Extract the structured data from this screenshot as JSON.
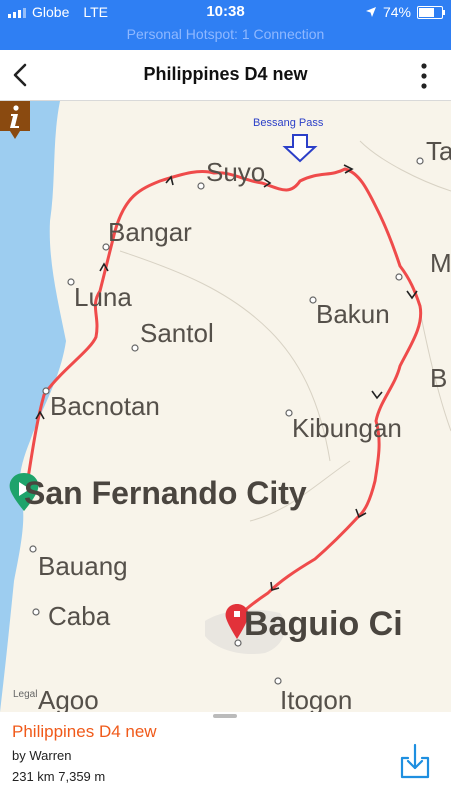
{
  "status_bar": {
    "carrier": "Globe",
    "network": "LTE",
    "time": "10:38",
    "battery": "74%",
    "battery_level": 0.74,
    "hotspot": "Personal Hotspot: 1 Connection"
  },
  "nav": {
    "title": "Philippines D4 new"
  },
  "map": {
    "annotation": "Bessang Pass",
    "legal": "Legal",
    "places": {
      "suyo": "Suyo",
      "ta": "Ta",
      "bangar": "Bangar",
      "ma": "Ma",
      "luna": "Luna",
      "bakun": "Bakun",
      "santol": "Santol",
      "b": "B",
      "bacnotan": "Bacnotan",
      "kibungan": "Kibungan",
      "san_fernando": "San Fernando City",
      "bauang": "Bauang",
      "caba": "Caba",
      "baguio": "Baguio Ci",
      "agoo": "Agoo",
      "itogon": "Itogon"
    },
    "colors": {
      "route": "#ef4b4b",
      "water": "#9dcdf0",
      "land": "#f8f4ea",
      "start_pin": "#1ea36b",
      "end_pin": "#e2323a",
      "info": "#8a4a10"
    }
  },
  "panel": {
    "route_name": "Philippines D4 new",
    "author": "by Warren",
    "stats": "231 km 7,359 m"
  },
  "icons": {
    "back": "chevron-left-icon",
    "more": "more-vertical-icon",
    "download": "download-icon",
    "location": "location-arrow-icon",
    "info": "info-icon",
    "start": "start-pin-icon",
    "end": "end-pin-icon"
  }
}
